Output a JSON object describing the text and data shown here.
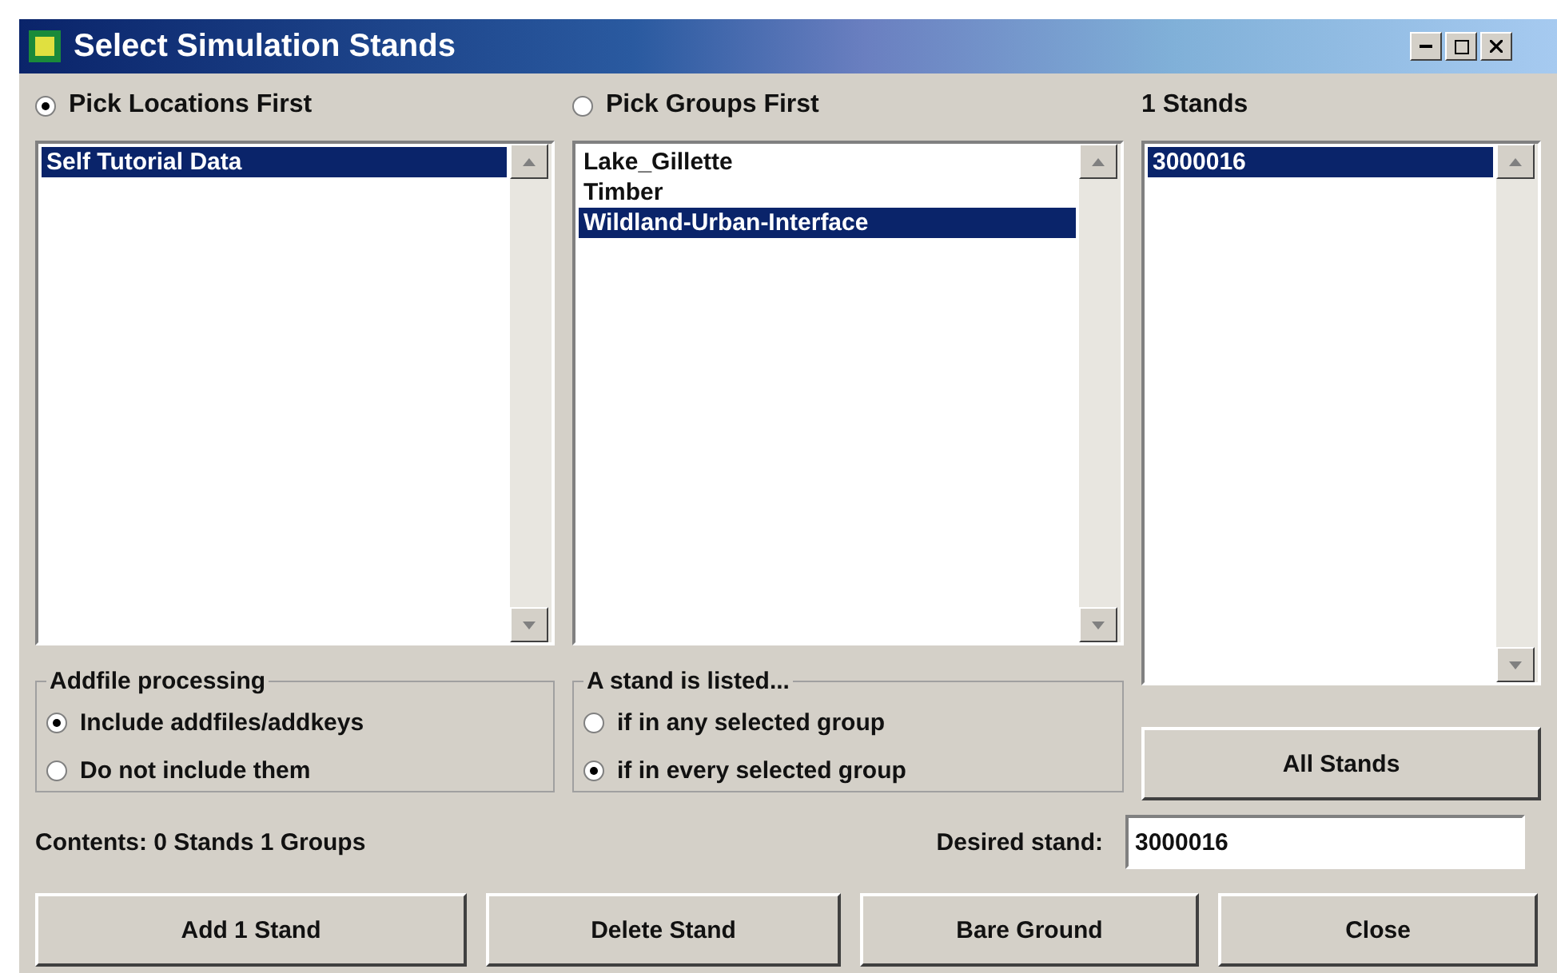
{
  "window": {
    "title": "Select Simulation Stands"
  },
  "modes": [
    {
      "label": "Pick Locations First",
      "selected": true
    },
    {
      "label": "Pick Groups First",
      "selected": false
    }
  ],
  "stands_heading": "1 Stands",
  "locations": [
    {
      "label": "Self Tutorial Data",
      "selected": true
    }
  ],
  "groups": [
    {
      "label": "Lake_Gillette",
      "selected": false
    },
    {
      "label": "Timber",
      "selected": false
    },
    {
      "label": "Wildland-Urban-Interface",
      "selected": true
    }
  ],
  "stands": [
    {
      "label": "3000016",
      "selected": true
    }
  ],
  "addfile_processing": {
    "title": "Addfile processing",
    "options": [
      {
        "label": "Include addfiles/addkeys",
        "selected": true
      },
      {
        "label": "Do not include them",
        "selected": false
      }
    ]
  },
  "listing_rule": {
    "title": "A stand is listed...",
    "options": [
      {
        "label": "if in any selected group",
        "selected": false
      },
      {
        "label": "if in every selected group",
        "selected": true
      }
    ]
  },
  "all_stands_button": "All Stands",
  "contents": "Contents: 0 Stands 1 Groups",
  "desired_stand": {
    "label": "Desired stand:",
    "value": "3000016"
  },
  "buttons": [
    "Add 1 Stand",
    "Delete Stand",
    "Bare Ground",
    "Close"
  ]
}
